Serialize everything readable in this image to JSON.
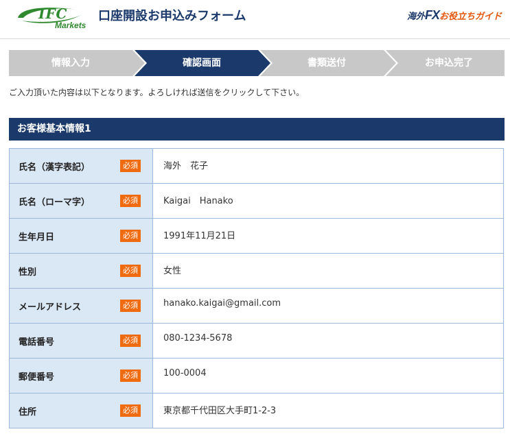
{
  "header": {
    "logo_top": "IFC",
    "logo_bottom": "Markets",
    "title": "口座開設お申込みフォーム",
    "guide_prefix": "海外",
    "guide_fx": "FX",
    "guide_suffix": "お役立ちガイド"
  },
  "steps": [
    {
      "label": "情報入力",
      "state": "inactive"
    },
    {
      "label": "確認画面",
      "state": "active"
    },
    {
      "label": "書類送付",
      "state": "inactive"
    },
    {
      "label": "お申込完了",
      "state": "inactive"
    }
  ],
  "colors": {
    "navy": "#1b3a6b",
    "step_inactive": "#c8c8c8",
    "label_bg": "#dae7f4",
    "required_badge": "#f06a0f",
    "logo_green": "#2f8a2f"
  },
  "intro": "ご入力頂いた内容は以下となります。よろしければ送信をクリックして下さい。",
  "section": {
    "title": "お客様基本情報1"
  },
  "required_label": "必須",
  "rows": [
    {
      "label": "氏名（漢字表記）",
      "value": "海外　花子"
    },
    {
      "label": "氏名（ローマ字）",
      "value": "Kaigai　Hanako"
    },
    {
      "label": "生年月日",
      "value": "1991年11月21日"
    },
    {
      "label": "性別",
      "value": "女性"
    },
    {
      "label": "メールアドレス",
      "value": "hanako.kaigai@gmail.com"
    },
    {
      "label": "電話番号",
      "value": "080-1234-5678"
    },
    {
      "label": "郵便番号",
      "value": "100-0004"
    },
    {
      "label": "住所",
      "value": "東京都千代田区大手町1-2-3"
    }
  ]
}
